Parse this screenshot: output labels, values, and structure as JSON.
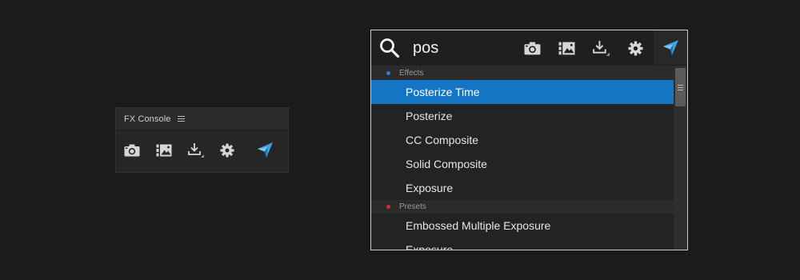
{
  "panel": {
    "title": "FX Console",
    "menu_icon": "hamburger-menu-icon",
    "toolbar": [
      {
        "name": "camera-icon"
      },
      {
        "name": "gallery-icon"
      },
      {
        "name": "download-icon"
      },
      {
        "name": "gear-icon"
      },
      {
        "name": "fx-console-logo-icon"
      }
    ]
  },
  "popup": {
    "search": {
      "value": "pos",
      "icon": "search-icon"
    },
    "toolbar": [
      {
        "name": "camera-icon"
      },
      {
        "name": "gallery-icon"
      },
      {
        "name": "download-icon"
      },
      {
        "name": "gear-icon"
      },
      {
        "name": "fx-console-logo-icon"
      }
    ],
    "sections": [
      {
        "label": "Effects",
        "dot_color": "#1f7fd1",
        "items": [
          "Posterize Time",
          "Posterize",
          "CC Composite",
          "Solid Composite",
          "Exposure"
        ],
        "selected_index": 0
      },
      {
        "label": "Presets",
        "dot_color": "#d22a2a",
        "items": [
          "Embossed Multiple Exposure",
          "Exposure"
        ]
      }
    ]
  },
  "colors": {
    "background": "#1b1b1b",
    "selection": "#1475c4",
    "accent_logo": "#3aa3e3"
  }
}
